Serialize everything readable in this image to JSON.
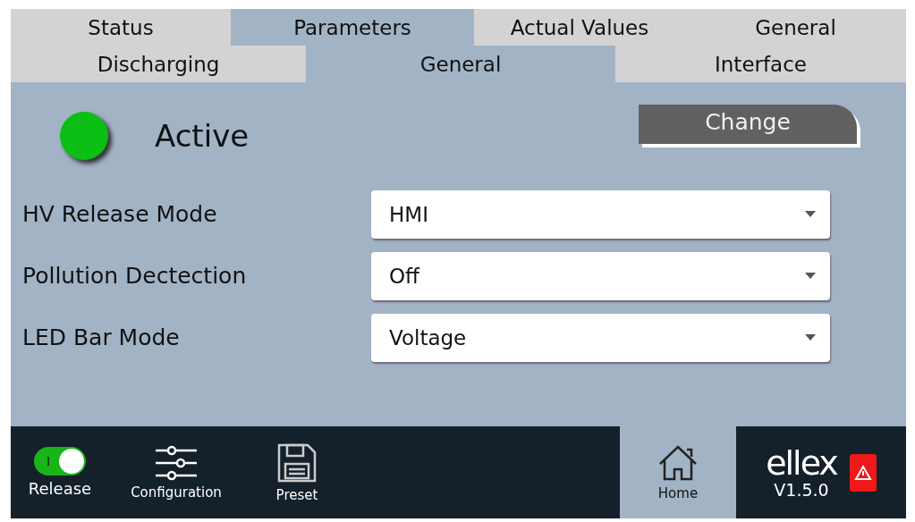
{
  "tabs_top": [
    {
      "label": "Status",
      "selected": false
    },
    {
      "label": "Parameters",
      "selected": true
    },
    {
      "label": "Actual Values",
      "selected": false
    },
    {
      "label": "General",
      "selected": false
    }
  ],
  "tabs_sub": [
    {
      "label": "Discharging",
      "selected": false
    },
    {
      "label": "General",
      "selected": true
    },
    {
      "label": "Interface",
      "selected": false
    }
  ],
  "status": {
    "label": "Active",
    "on": true
  },
  "change_button": "Change",
  "settings": [
    {
      "label": "HV Release Mode",
      "value": "HMI"
    },
    {
      "label": "Pollution Dectection",
      "value": "Off"
    },
    {
      "label": "LED Bar Mode",
      "value": "Voltage"
    }
  ],
  "nav": {
    "release": {
      "label": "Release",
      "on": true,
      "switch_text": "I"
    },
    "items": [
      {
        "kind": "sliders",
        "label": "Configuration",
        "selected": false
      },
      {
        "kind": "disk",
        "label": "Preset",
        "selected": false
      },
      {
        "kind": "home",
        "label": "Home",
        "selected": true
      }
    ],
    "logo": "ellex",
    "version": "V1.5.0"
  }
}
